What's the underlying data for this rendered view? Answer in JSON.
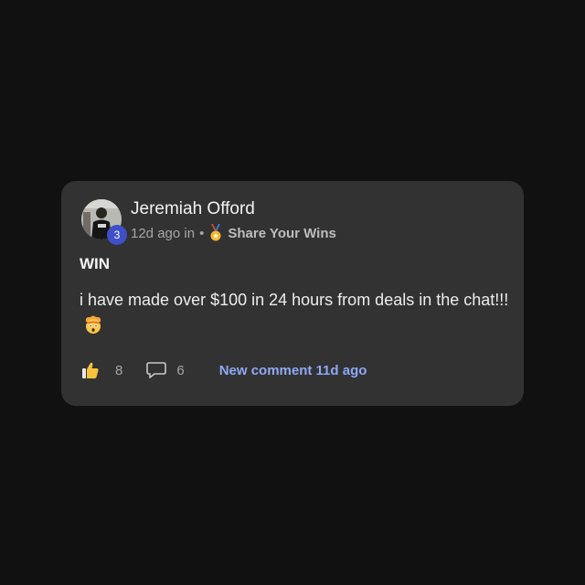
{
  "post": {
    "author": "Jeremiah Offord",
    "level": "3",
    "time": "12d ago in",
    "separator": "•",
    "category_icon": "medal-icon",
    "category": "Share Your Wins",
    "title": "WIN",
    "body": "i have made over $100 in 24 hours from deals in the chat!!!",
    "body_emoji": "exploding-head-emoji",
    "likes": "8",
    "comments": "6",
    "last_activity": "New comment 11d ago"
  },
  "colors": {
    "background": "#111111",
    "card": "#323232",
    "level_badge": "#3e4fc7",
    "link": "#8fa8f5",
    "like_icon": "#f5c33b"
  }
}
